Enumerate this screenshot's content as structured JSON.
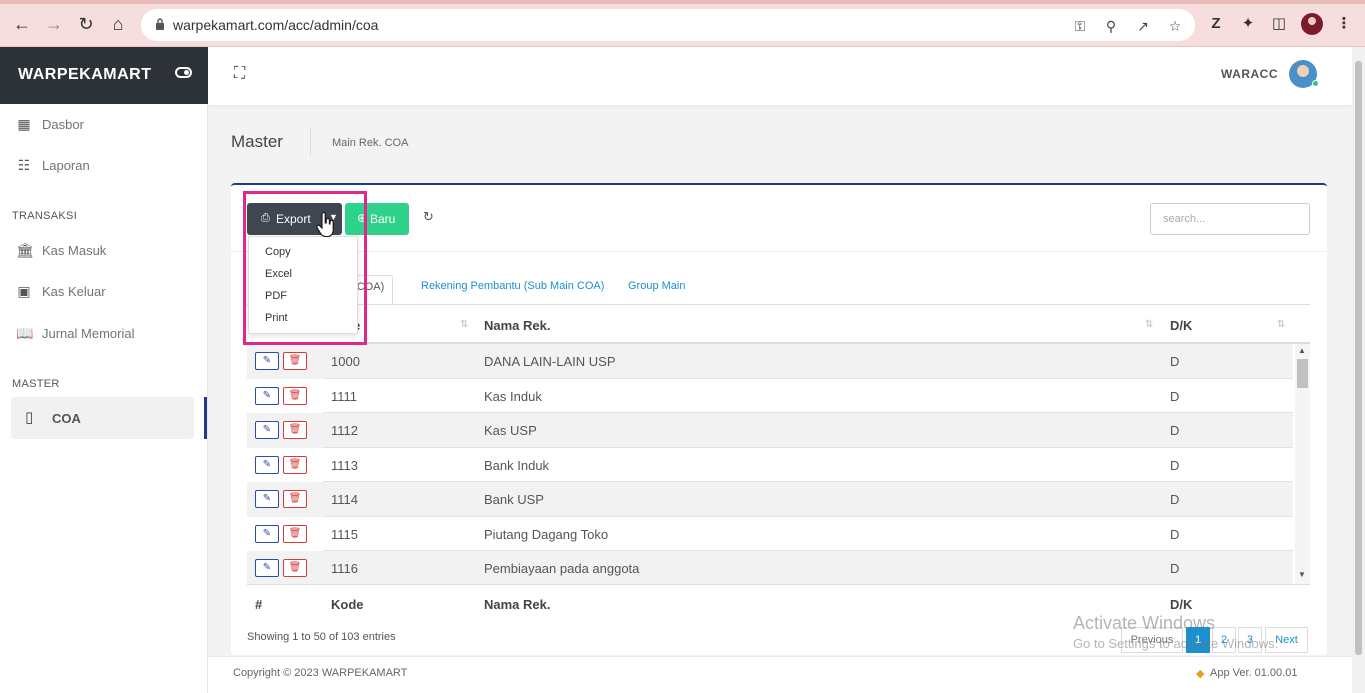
{
  "browser": {
    "url": "warpekamart.com/acc/admin/coa"
  },
  "sidebar": {
    "brand": "WARPEKAMART",
    "items_top": [
      {
        "label": "Dasbor",
        "icon": "table-icon"
      },
      {
        "label": "Laporan",
        "icon": "clipboard-icon"
      }
    ],
    "section_transaksi": "TRANSAKSI",
    "items_transaksi": [
      {
        "label": "Kas Masuk",
        "icon": "bank-icon"
      },
      {
        "label": "Kas Keluar",
        "icon": "cash-icon"
      },
      {
        "label": "Jurnal Memorial",
        "icon": "book-icon"
      }
    ],
    "section_master": "MASTER",
    "active_item": "COA"
  },
  "header": {
    "user": "WARACC"
  },
  "page": {
    "title": "Master",
    "subtitle": "Main Rek. COA"
  },
  "toolbar": {
    "export_label": "Export",
    "new_label": "Baru",
    "search_placeholder": "search..."
  },
  "dropdown": {
    "items": [
      "Copy",
      "Excel",
      "PDF",
      "Print"
    ]
  },
  "tabs": [
    {
      "label": "ain COA)"
    },
    {
      "label": "Rekening Pembantu (Sub Main COA)"
    },
    {
      "label": "Group Main"
    }
  ],
  "table": {
    "header": {
      "kode": "e",
      "nama": "Nama Rek.",
      "dk": "D/K"
    },
    "footer": {
      "num": "#",
      "kode": "Kode",
      "nama": "Nama Rek.",
      "dk": "D/K"
    },
    "rows": [
      {
        "kode": "1000",
        "nama": "DANA LAIN-LAIN USP",
        "dk": "D"
      },
      {
        "kode": "1111",
        "nama": "Kas Induk",
        "dk": "D"
      },
      {
        "kode": "1112",
        "nama": "Kas USP",
        "dk": "D"
      },
      {
        "kode": "1113",
        "nama": "Bank Induk",
        "dk": "D"
      },
      {
        "kode": "1114",
        "nama": "Bank USP",
        "dk": "D"
      },
      {
        "kode": "1115",
        "nama": "Piutang Dagang Toko",
        "dk": "D"
      },
      {
        "kode": "1116",
        "nama": "Pembiayaan pada anggota",
        "dk": "D"
      }
    ],
    "info": "Showing 1 to 50 of 103 entries"
  },
  "pagination": {
    "previous": "Previous",
    "pages": [
      "1",
      "2",
      "3"
    ],
    "next": "Next"
  },
  "footer": {
    "copyright": "Copyright © 2023 WARPEKAMART",
    "version": "App Ver. 01.00.01"
  },
  "watermark": {
    "line1": "Activate Windows",
    "line2": "Go to Settings to activate Windows."
  },
  "colors": {
    "brand_dark": "#2d3238",
    "accent_blue": "#1f3a88",
    "success_green": "#2fd28a",
    "link_blue": "#1a8fd1",
    "highlight_pink": "#e0288a"
  }
}
